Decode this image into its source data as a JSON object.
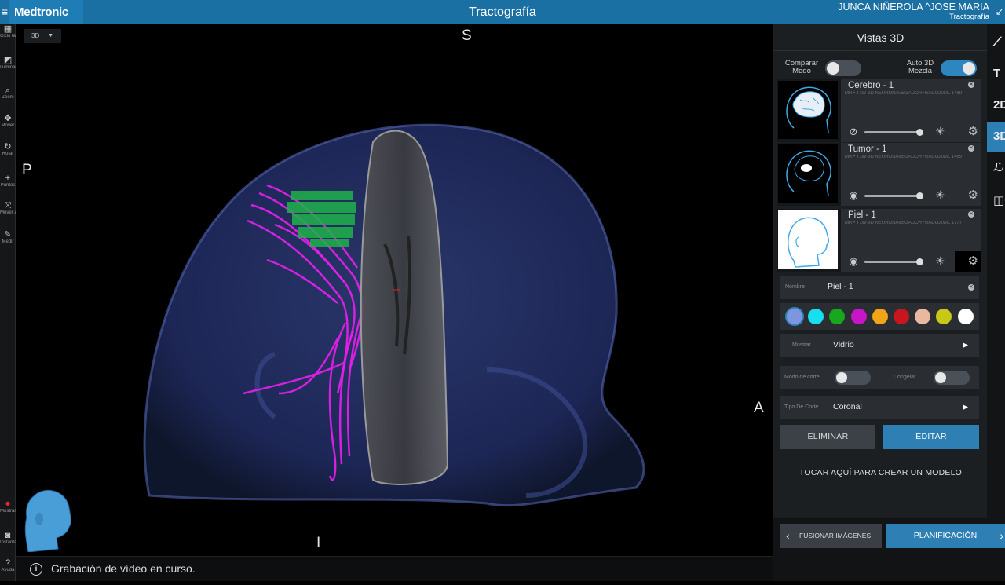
{
  "header": {
    "menu_icon": "hamburger-icon",
    "brand": "Medtronic",
    "title": "Tractografía",
    "patient_name": "JUNCA NIÑEROLA ^JOSE MARIA",
    "patient_sub": "Tractografía",
    "back_icon": "collapse-arrow-icon"
  },
  "left_tools": [
    {
      "icon": "grid-icon",
      "glyph": "▦",
      "label": "Ciclo tamaños"
    },
    {
      "icon": "window-icon",
      "glyph": "◩",
      "label": "Iluminar"
    },
    {
      "icon": "zoom-icon",
      "glyph": "⌕",
      "label": "Zoom"
    },
    {
      "icon": "move-icon",
      "glyph": "✥",
      "label": "Mover"
    },
    {
      "icon": "rotate-icon",
      "glyph": "↻",
      "label": "Rotar"
    },
    {
      "icon": "crosshair-icon",
      "glyph": "+",
      "label": "Puntos"
    },
    {
      "icon": "expand-icon",
      "glyph": "⤧",
      "label": "Mover a centrar"
    },
    {
      "icon": "measure-icon",
      "glyph": "✎",
      "label": "Medir"
    },
    {
      "icon": "record-icon",
      "glyph": "⏺",
      "label": "Mostrar"
    },
    {
      "icon": "screenshot-icon",
      "glyph": "◙",
      "label": "Instantánea"
    },
    {
      "icon": "help-icon",
      "glyph": "?",
      "label": "Ayuda"
    }
  ],
  "viewport": {
    "view_mode": "3D",
    "orientation": {
      "top": "S",
      "bottom": "I",
      "left": "P",
      "right": "A"
    }
  },
  "status": {
    "icon": "info-icon",
    "text": "Grabación de vídeo en curso."
  },
  "panel": {
    "title": "Vistas 3D",
    "compare_label": "Comparar Modo",
    "compare_on": false,
    "auto_label": "Auto 3D Mezcla",
    "auto_on": true,
    "models": [
      {
        "name": "Cerebro - 1",
        "desc": "MR • T1W-3D NEURONAVEGADOR+GADO20ML 1469",
        "visible": false,
        "opacity": 1.0,
        "thumb": "brain"
      },
      {
        "name": "Tumor - 1",
        "desc": "MR • T1W-3D NEURONAVEGADOR+GADO20ML 1469",
        "visible": true,
        "opacity": 1.0,
        "thumb": "tumor"
      },
      {
        "name": "Piel - 1",
        "desc": "MR • T1W-3D NEURONAVEGADOR+GADO20ML 1777",
        "visible": true,
        "opacity": 1.0,
        "thumb": "skin"
      }
    ],
    "editor": {
      "name_label": "Nombre",
      "name_value": "Piel - 1",
      "colors": [
        "#7f95e0",
        "#16e0f0",
        "#18a81e",
        "#c815c8",
        "#f0a418",
        "#c8161e",
        "#eab8a0",
        "#c8c818",
        "#ffffff"
      ],
      "selected_color": 0,
      "show_label": "Mostrar",
      "show_value": "Vidrio",
      "cut_mode_label": "Modo de corte",
      "cut_mode_on": false,
      "freeze_label": "Congelar",
      "freeze_on": false,
      "cut_type_label": "Tipo De Corte",
      "cut_type_value": "Coronal",
      "delete_label": "ELIMINAR",
      "edit_label": "EDITAR"
    },
    "create_model": "TOCAR AQUÍ PARA CREAR UN MODELO"
  },
  "nav": {
    "prev_label": "FUSIONAR IMÁGENES",
    "next_label": "PLANIFICACIÓN"
  },
  "right_rail": [
    {
      "icon": "trajectory-icon",
      "glyph": "⟋",
      "active": false
    },
    {
      "icon": "text-tool-icon",
      "glyph": "T",
      "active": false
    },
    {
      "icon": "view-2d-icon",
      "glyph": "2D",
      "active": false
    },
    {
      "icon": "view-3d-icon",
      "glyph": "3D",
      "active": true
    },
    {
      "icon": "signature-icon",
      "glyph": "ℒ",
      "active": false
    },
    {
      "icon": "layout-icon",
      "glyph": "◫",
      "active": false
    }
  ]
}
